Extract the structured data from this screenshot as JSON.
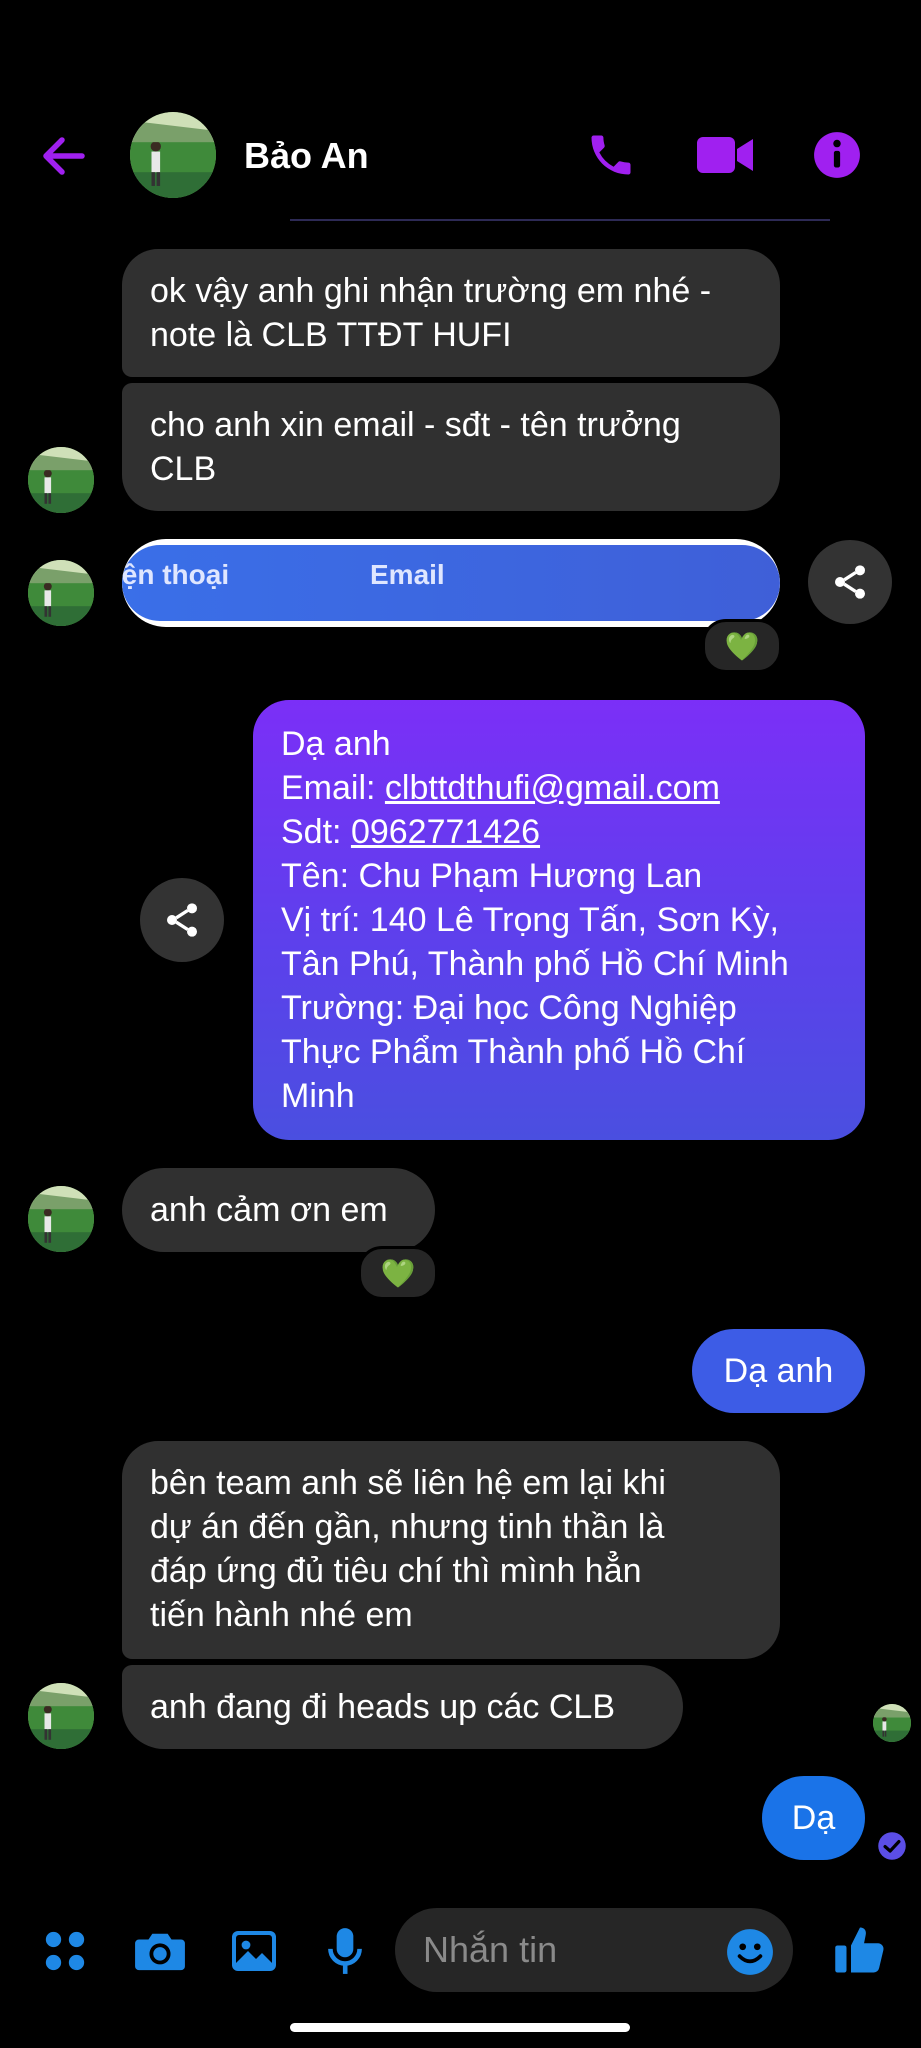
{
  "header": {
    "contact_name": "Bảo An",
    "back_icon": "arrow-left-icon",
    "call_icon": "phone-icon",
    "video_icon": "video-camera-icon",
    "info_icon": "info-icon",
    "accent": "#a020f0"
  },
  "messages": [
    {
      "from": "them",
      "lines": [
        "ok vậy anh ghi nhận trường em nhé -",
        "note là CLB TTĐT HUFI"
      ]
    },
    {
      "from": "them",
      "lines": [
        "cho anh xin email - sđt - tên trưởng",
        "CLB"
      ]
    },
    {
      "from": "them",
      "type": "form-card",
      "labels": [
        "iện thoại",
        "Email"
      ],
      "reaction": "💚"
    },
    {
      "from": "me",
      "lines": [
        "Dạ anh",
        "Email: ",
        "Sdt: ",
        "Tên: Chu Phạm Hương Lan",
        "Vị trí: 140 Lê Trọng Tấn, Sơn Kỳ,",
        "Tân Phú, Thành phố Hồ Chí Minh",
        "Trường: Đại học Công Nghiệp",
        "Thực Phẩm Thành phố Hồ Chí",
        "Minh"
      ],
      "email": "clbttdthufi@gmail.com",
      "phone": "0962771426"
    },
    {
      "from": "them",
      "lines": [
        "anh cảm ơn em"
      ],
      "reaction": "💚"
    },
    {
      "from": "me",
      "lines": [
        "Dạ anh"
      ]
    },
    {
      "from": "them",
      "lines": [
        "bên team anh sẽ liên hệ em lại khi",
        "dự án đến gần, nhưng tinh thần là",
        "đáp ứng đủ tiêu chí thì mình hẳn",
        "tiến hành nhé em"
      ]
    },
    {
      "from": "them",
      "lines": [
        "anh đang đi heads up các CLB"
      ]
    },
    {
      "from": "me",
      "lines": [
        "Dạ"
      ]
    }
  ],
  "composer": {
    "placeholder": "Nhắn tin",
    "icons": [
      "apps-icon",
      "camera-icon",
      "gallery-icon",
      "microphone-icon",
      "emoji-icon",
      "thumbs-up-icon"
    ],
    "accent": "#1e88e5"
  },
  "colors": {
    "incoming_bubble": "#303030",
    "outgoing_gradient_top": "#7b2ff7",
    "outgoing_gradient_bottom": "#4a4fe0",
    "outgoing_blue": "#3d5ce6",
    "last_blue": "#1a73e8"
  }
}
